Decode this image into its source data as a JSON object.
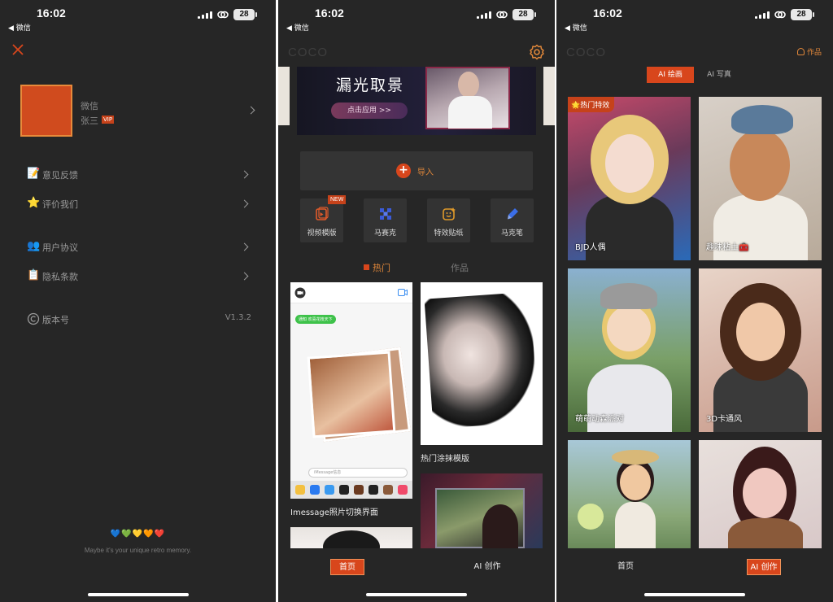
{
  "status": {
    "time": "16:02",
    "back_app": "◀ 微信",
    "battery": "28"
  },
  "screen1": {
    "profile": {
      "name": "微信",
      "user": "张三",
      "badge": "VIP"
    },
    "menu": [
      {
        "icon": "memo-icon",
        "emoji": "📝",
        "label": "意见反馈"
      },
      {
        "icon": "star-icon",
        "emoji": "⭐",
        "label": "评价我们"
      },
      {
        "icon": "users-icon",
        "emoji": "👥",
        "label": "用户协议"
      },
      {
        "icon": "clipboard-icon",
        "emoji": "📋",
        "label": "隐私条款"
      }
    ],
    "version": {
      "label": "版本号",
      "value": "V1.3.2"
    },
    "hearts": "💙💚💛🧡❤️",
    "tagline": "Maybe it's your unique retro memory."
  },
  "screen2": {
    "brand": "COCO",
    "banner": {
      "title": "漏光取景",
      "apply": "点击应用 >>"
    },
    "import_label": "导入",
    "tools": [
      {
        "label": "视频模版",
        "icon": "video-template-icon"
      },
      {
        "label": "马赛克",
        "icon": "mosaic-icon"
      },
      {
        "label": "特效贴纸",
        "icon": "sticker-icon"
      },
      {
        "label": "马克笔",
        "icon": "marker-icon"
      }
    ],
    "new_badge": "NEW",
    "tabs": {
      "hot": "热门",
      "works": "作品"
    },
    "cards": [
      {
        "caption": "Imessage照片切换界面"
      },
      {
        "caption": "热门涂抹模版"
      }
    ],
    "phone_mock": {
      "bubble": "通知 欢喜花枝天下",
      "input_placeholder": "iMessage信息"
    },
    "nav": {
      "home": "首页",
      "ai": "AI 创作"
    }
  },
  "screen3": {
    "brand": "COCO",
    "works_link": "作品",
    "segments": {
      "active": "AI 绘画",
      "idle": "AI 写真"
    },
    "hot_tag": "🌟热门特效",
    "styles": [
      {
        "caption": "BJD人偶"
      },
      {
        "caption": "趣味粘土🧰"
      },
      {
        "caption": "萌萌动森派对"
      },
      {
        "caption": "3D卡通风"
      },
      {
        "caption": ""
      },
      {
        "caption": ""
      }
    ],
    "nav": {
      "home": "首页",
      "ai": "AI 创作"
    }
  },
  "colors": {
    "accent": "#d8461c",
    "accent_text": "#e0873a",
    "bg": "#262626"
  }
}
